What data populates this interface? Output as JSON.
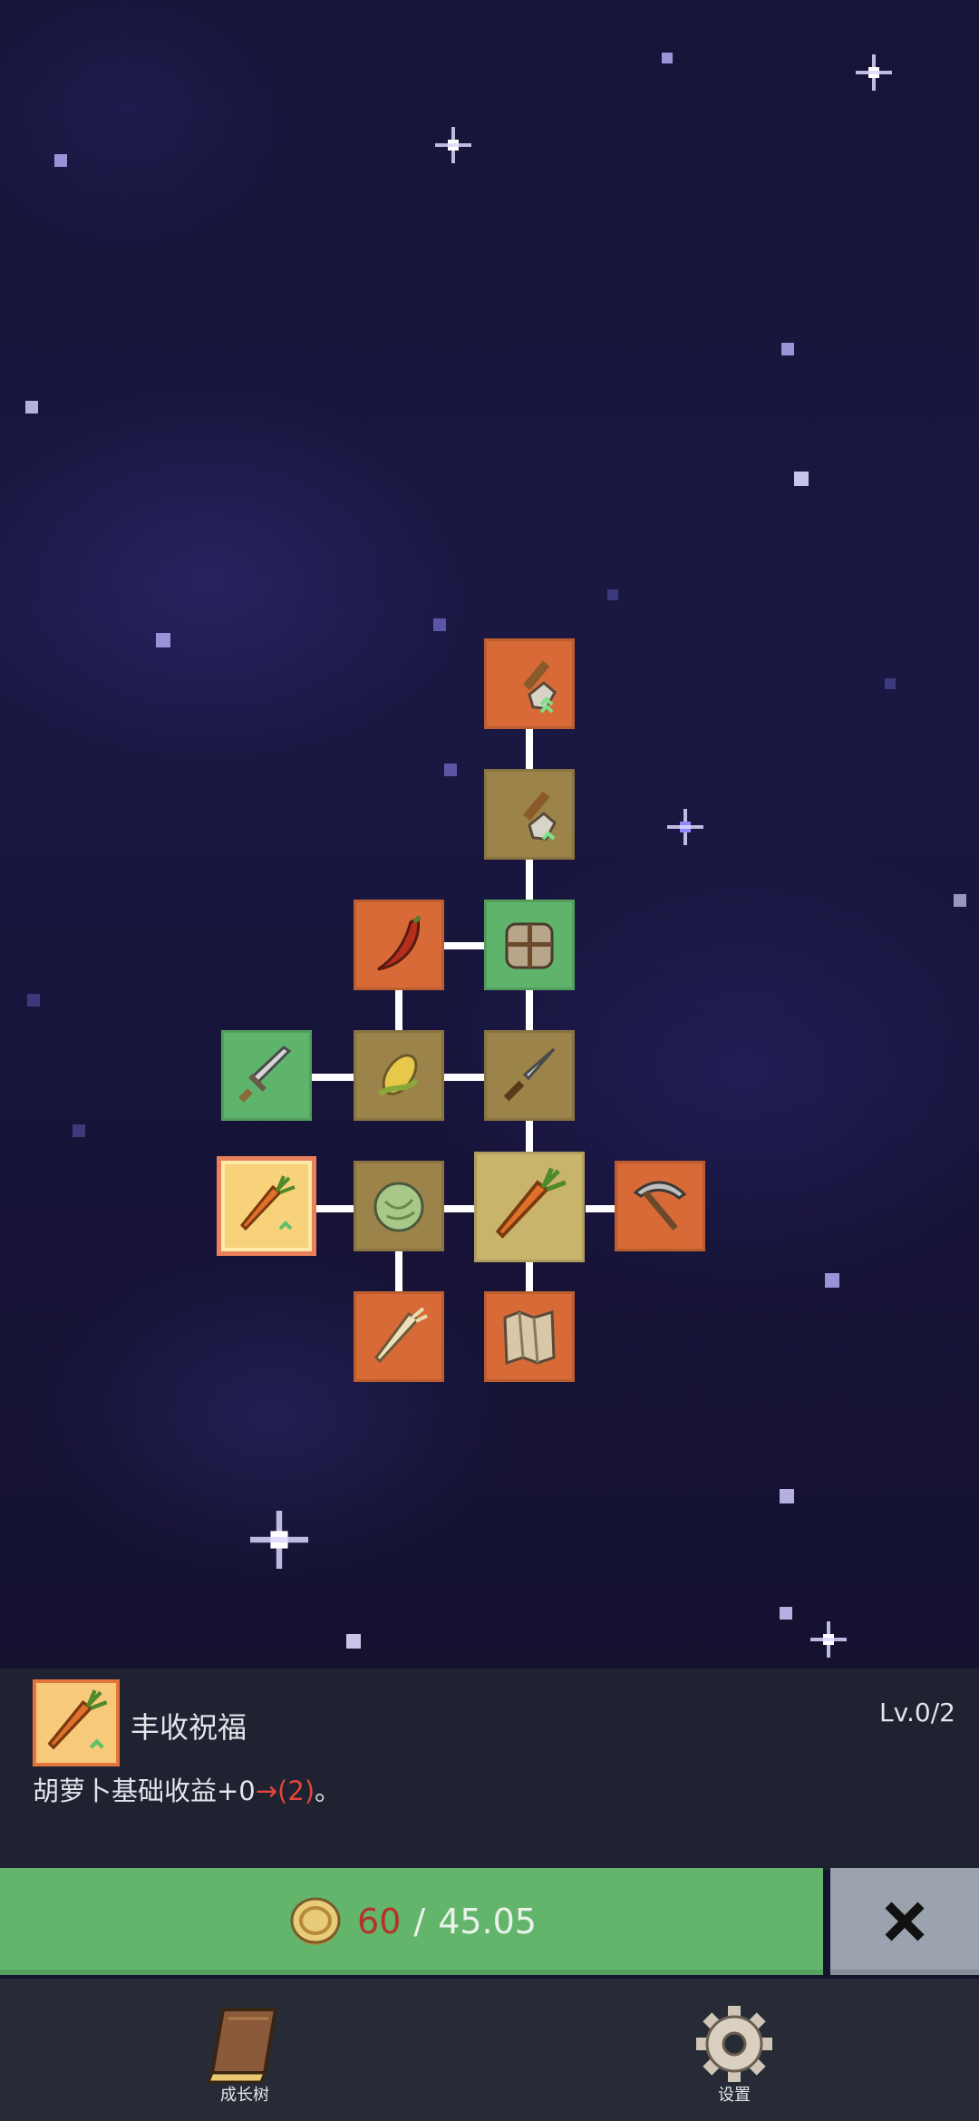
{
  "skill_tree": {
    "nodes": [
      {
        "name": "shovel-upgrade-node",
        "icon": "shovel-upgrade-icon",
        "color": "#d76a37"
      },
      {
        "name": "shovel-node",
        "icon": "shovel-icon",
        "color": "#9c834a"
      },
      {
        "name": "chili-node",
        "icon": "chili-pepper-icon",
        "color": "#d76a37"
      },
      {
        "name": "backpack-node",
        "icon": "backpack-icon",
        "color": "#5fb46c"
      },
      {
        "name": "sword-node",
        "icon": "sword-icon",
        "color": "#5fb46c"
      },
      {
        "name": "corn-node",
        "icon": "corn-icon",
        "color": "#9c834a"
      },
      {
        "name": "knife-node",
        "icon": "knife-icon",
        "color": "#9c834a"
      },
      {
        "name": "carrot-blessing-node",
        "icon": "carrot-upgrade-icon",
        "color": "#f7d27a",
        "selected": true
      },
      {
        "name": "cabbage-node",
        "icon": "cabbage-icon",
        "color": "#9c834a"
      },
      {
        "name": "carrot-root-node",
        "icon": "carrot-icon",
        "color": "#c9b46b"
      },
      {
        "name": "pickaxe-node",
        "icon": "pickaxe-icon",
        "color": "#d76a37"
      },
      {
        "name": "parsnip-node",
        "icon": "parsnip-icon",
        "color": "#d76a37"
      },
      {
        "name": "map-node",
        "icon": "map-icon",
        "color": "#d76a37"
      }
    ]
  },
  "panel": {
    "skill_name": "丰收祝福",
    "level": "Lv.0/2",
    "desc_prefix": "胡萝卜基础收益+0",
    "desc_arrow": "→(2)",
    "desc_suffix": "。"
  },
  "upgrade": {
    "current": "60",
    "separator": "/",
    "required": "45.05"
  },
  "nav": {
    "growth_tree_label": "成长树",
    "settings_label": "设置"
  },
  "colors": {
    "upgrade_bg": "#63b56c",
    "close_bg": "#9aa3ae",
    "cost_current": "#b5312a",
    "highlight_red": "#e2463a"
  }
}
